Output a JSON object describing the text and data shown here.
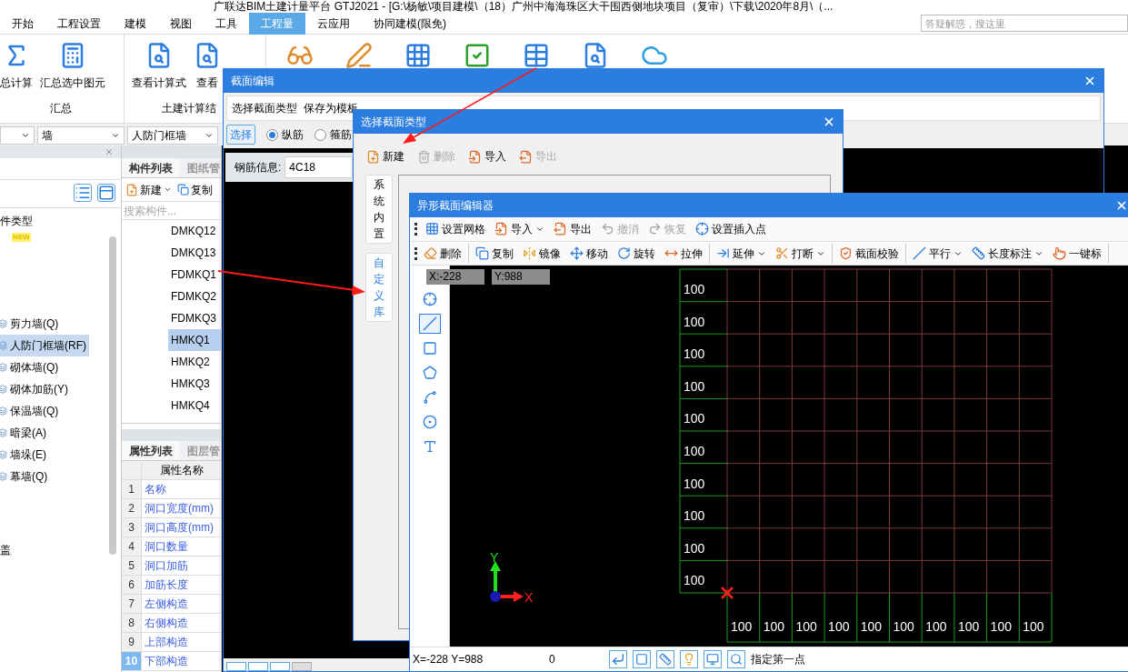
{
  "app": {
    "title": "广联达BIM土建计量平台 GTJ2021 - [G:\\杨敏\\项目建模\\（18）广州中海海珠区大干围西侧地块项目（复审）\\下载\\2020年8月\\（...",
    "menu_tabs": [
      {
        "label": "开始",
        "selected": false
      },
      {
        "label": "工程设置",
        "selected": false
      },
      {
        "label": "建模",
        "selected": false
      },
      {
        "label": "视图",
        "selected": false
      },
      {
        "label": "工具",
        "selected": false
      },
      {
        "label": "工程量",
        "selected": true
      },
      {
        "label": "云应用",
        "selected": false
      },
      {
        "label": "协同建模(限免)",
        "selected": false
      }
    ],
    "search": {
      "placeholder": "答疑解惑，搜这里"
    },
    "ribbon_groups": [
      {
        "label": "汇总",
        "buttons": [
          {
            "label": "总计算",
            "kind": "sum"
          },
          {
            "label": "汇总选中图元",
            "kind": "sum-selected"
          }
        ]
      },
      {
        "label": "土建计算结",
        "buttons": [
          {
            "label": "查看计算式",
            "kind": "formula"
          },
          {
            "label": "查看",
            "kind": "quantity"
          }
        ]
      }
    ],
    "filters": [
      "墙",
      "人防门框墙"
    ],
    "component_types": {
      "heading": "件类型",
      "badge": "NEW",
      "items": [
        {
          "label": "剪力墙(Q)",
          "selected": false
        },
        {
          "label": "人防门框墙(RF)",
          "selected": true
        },
        {
          "label": "砌体墙(Q)",
          "selected": false
        },
        {
          "label": "砌体加筋(Y)",
          "selected": false
        },
        {
          "label": "保温墙(Q)",
          "selected": false
        },
        {
          "label": "暗梁(A)",
          "selected": false
        },
        {
          "label": "墙垛(E)",
          "selected": false
        },
        {
          "label": "幕墙(Q)",
          "selected": false
        }
      ],
      "footer": "盖"
    },
    "component_list": {
      "tabs": [
        {
          "label": "构件列表",
          "selected": true
        },
        {
          "label": "图纸管",
          "selected": false
        }
      ],
      "new_label": "新建",
      "copy_label": "复制",
      "search_placeholder": "搜索构件...",
      "items": [
        {
          "label": "DMKQ12",
          "selected": false
        },
        {
          "label": "DMKQ13",
          "selected": false
        },
        {
          "label": "FDMKQ1",
          "selected": false
        },
        {
          "label": "FDMKQ2",
          "selected": false
        },
        {
          "label": "FDMKQ3",
          "selected": false
        },
        {
          "label": "HMKQ1",
          "selected": true
        },
        {
          "label": "HMKQ2",
          "selected": false
        },
        {
          "label": "HMKQ3",
          "selected": false
        },
        {
          "label": "HMKQ4",
          "selected": false
        }
      ]
    },
    "properties": {
      "tabs": [
        {
          "label": "属性列表",
          "selected": true
        },
        {
          "label": "图层管",
          "selected": false
        }
      ],
      "header": "属性名称",
      "rows": [
        {
          "index": "1",
          "name": "名称",
          "selected": false
        },
        {
          "index": "2",
          "name": "洞口宽度(mm)",
          "selected": false
        },
        {
          "index": "3",
          "name": "洞口高度(mm)",
          "selected": false
        },
        {
          "index": "4",
          "name": "洞口数量",
          "selected": false
        },
        {
          "index": "5",
          "name": "洞口加筋",
          "selected": false
        },
        {
          "index": "6",
          "name": "加筋长度",
          "selected": false
        },
        {
          "index": "7",
          "name": "左侧构造",
          "selected": false
        },
        {
          "index": "8",
          "name": "右侧构造",
          "selected": false
        },
        {
          "index": "9",
          "name": "上部构造",
          "selected": false
        },
        {
          "index": "10",
          "name": "下部构造",
          "selected": true
        }
      ]
    }
  },
  "section_editor": {
    "title": "截面编辑",
    "toolbar": [
      "选择截面类型",
      "保存为模板"
    ],
    "select_button": "选择",
    "rebar_types": [
      {
        "label": "纵筋",
        "selected": true
      },
      {
        "label": "箍筋",
        "selected": false
      }
    ],
    "rebar_info": {
      "label": "钢筋信息:",
      "value": "4C18"
    }
  },
  "section_type_dialog": {
    "title": "选择截面类型",
    "toolbar": [
      {
        "label": "新建",
        "kind": "new",
        "disabled": false
      },
      {
        "label": "删除",
        "kind": "delete",
        "disabled": true
      },
      {
        "label": "导入",
        "kind": "import",
        "disabled": false
      },
      {
        "label": "导出",
        "kind": "export",
        "disabled": true
      }
    ],
    "side_tabs": [
      {
        "label": "系统内置",
        "selected": false
      },
      {
        "label": "自定义库",
        "selected": true
      }
    ]
  },
  "shape_editor": {
    "title": "异形截面编辑器",
    "toolbar_1": [
      {
        "label": "设置网格",
        "kind": "grid",
        "disabled": false,
        "dropdown": false
      },
      {
        "label": "导入",
        "kind": "import",
        "disabled": false,
        "dropdown": true
      },
      {
        "label": "导出",
        "kind": "export",
        "disabled": false,
        "dropdown": false
      },
      {
        "label": "撤消",
        "kind": "undo",
        "disabled": true,
        "dropdown": false
      },
      {
        "label": "恢复",
        "kind": "redo",
        "disabled": true,
        "dropdown": false
      },
      {
        "label": "设置插入点",
        "kind": "insert-point",
        "disabled": false,
        "dropdown": false
      }
    ],
    "toolbar_2": [
      [
        {
          "label": "删除",
          "kind": "erase",
          "disabled": false,
          "dropdown": false
        }
      ],
      [
        {
          "label": "复制",
          "kind": "copy",
          "disabled": false,
          "dropdown": false
        },
        {
          "label": "镜像",
          "kind": "mirror",
          "disabled": false,
          "dropdown": false
        },
        {
          "label": "移动",
          "kind": "move",
          "disabled": false,
          "dropdown": false
        },
        {
          "label": "旋转",
          "kind": "rotate",
          "disabled": false,
          "dropdown": false
        },
        {
          "label": "拉伸",
          "kind": "stretch",
          "disabled": false,
          "dropdown": false
        }
      ],
      [
        {
          "label": "延伸",
          "kind": "extend",
          "disabled": false,
          "dropdown": true
        },
        {
          "label": "打断",
          "kind": "break",
          "disabled": false,
          "dropdown": true
        }
      ],
      [
        {
          "label": "截面校验",
          "kind": "check",
          "disabled": false,
          "dropdown": false
        }
      ],
      [
        {
          "label": "平行",
          "kind": "parallel",
          "disabled": false,
          "dropdown": true
        },
        {
          "label": "长度标注",
          "kind": "dimension",
          "disabled": false,
          "dropdown": true
        },
        {
          "label": "一键标",
          "kind": "one-click",
          "disabled": false,
          "dropdown": false
        }
      ]
    ],
    "tools": [
      {
        "kind": "point",
        "selected": false
      },
      {
        "kind": "line",
        "selected": true
      },
      {
        "kind": "rectangle",
        "selected": false
      },
      {
        "kind": "polygon",
        "selected": false
      },
      {
        "kind": "arc",
        "selected": false
      },
      {
        "kind": "circle",
        "selected": false
      },
      {
        "kind": "text",
        "selected": false
      }
    ],
    "cursor": {
      "x": "X:-228",
      "y": "Y:988"
    },
    "grid": {
      "row_labels": [
        "100",
        "100",
        "100",
        "100",
        "100",
        "100",
        "100",
        "100",
        "100",
        "100"
      ],
      "column_labels": [
        "100",
        "100",
        "100",
        "100",
        "100",
        "100",
        "100",
        "100",
        "100",
        "100"
      ]
    },
    "axes": {
      "x": "X",
      "y": "Y"
    },
    "status": {
      "position": "X=-228 Y=988",
      "angle": "0",
      "prompt": "指定第一点"
    }
  }
}
